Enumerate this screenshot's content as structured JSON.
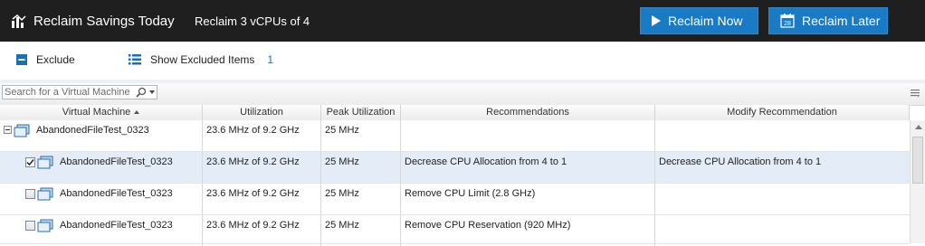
{
  "header": {
    "title": "Reclaim Savings Today",
    "subtitle": "Reclaim 3 vCPUs of 4",
    "reclaim_now_label": "Reclaim Now",
    "reclaim_later_label": "Reclaim Later",
    "calendar_day": "28",
    "button_color": "#1a7bc4"
  },
  "toolbar": {
    "exclude_label": "Exclude",
    "show_excluded_label": "Show Excluded Items",
    "excluded_count": "1"
  },
  "search": {
    "placeholder": "Search for a Virtual Machine"
  },
  "columns": [
    {
      "label": "Virtual Machine"
    },
    {
      "label": "Utilization"
    },
    {
      "label": "Peak Utilization"
    },
    {
      "label": "Recommendations"
    },
    {
      "label": "Modify Recommendation"
    }
  ],
  "rows": [
    {
      "name": "AbandonedFileTest_0323",
      "utilization": "23.6 MHz of 9.2 GHz",
      "peak": "25 MHz",
      "recommendation": "",
      "modify": "",
      "type": "parent",
      "checked": false
    },
    {
      "name": "AbandonedFileTest_0323",
      "utilization": "23.6 MHz of 9.2 GHz",
      "peak": "25 MHz",
      "recommendation": "Decrease CPU Allocation from 4 to 1",
      "modify": "Decrease CPU Allocation from 4 to 1",
      "type": "child",
      "checked": true
    },
    {
      "name": "AbandonedFileTest_0323",
      "utilization": "23.6 MHz of 9.2 GHz",
      "peak": "25 MHz",
      "recommendation": "Remove CPU Limit (2.8 GHz)",
      "modify": "",
      "type": "child",
      "checked": false
    },
    {
      "name": "AbandonedFileTest_0323",
      "utilization": "23.6 MHz of 9.2 GHz",
      "peak": "25 MHz",
      "recommendation": "Remove CPU Reservation (920 MHz)",
      "modify": "",
      "type": "child",
      "checked": false
    }
  ]
}
